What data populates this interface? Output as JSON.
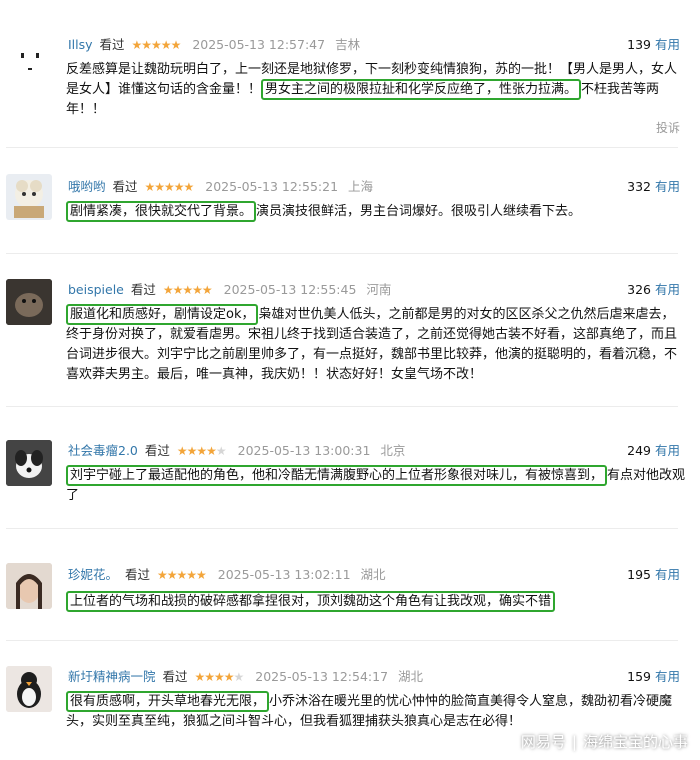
{
  "reviews": [
    {
      "user": "Illsy",
      "watched": "看过",
      "stars": 5,
      "time": "2025-05-13 12:57:47",
      "location": "吉林",
      "votes": "139",
      "useful": "有用",
      "text_before": "反差感算是让魏劭玩明白了，上一刻还是地狱修罗，下一刻秒变纯情狼狗，苏的一批！【男人是男人，女人是女人】谁懂这句话的含金量！！",
      "highlight": "男女主之间的极限拉扯和化学反应绝了，性张力拉满。",
      "text_after": "不枉我苦等两年！！",
      "report": "投诉"
    },
    {
      "user": "哦哟哟",
      "watched": "看过",
      "stars": 5,
      "time": "2025-05-13 12:55:21",
      "location": "上海",
      "votes": "332",
      "useful": "有用",
      "text_before": "",
      "highlight": "剧情紧凑，很快就交代了背景。",
      "text_after": "演员演技很鲜活，男主台词爆好。很吸引人继续看下去。"
    },
    {
      "user": "beispiele",
      "watched": "看过",
      "stars": 5,
      "time": "2025-05-13 12:55:45",
      "location": "河南",
      "votes": "326",
      "useful": "有用",
      "text_before": "",
      "highlight": "服道化和质感好，剧情设定ok，",
      "text_after": "枭雄对世仇美人低头，之前都是男的对女的区区杀父之仇然后虐来虐去，终于身份对换了，就爱看虐男。宋祖儿终于找到适合装造了，之前还觉得她古装不好看，这部真绝了，而且台词进步很大。刘宇宁比之前剧里帅多了，有一点挺好，魏部书里比较莽，他演的挺聪明的，看着沉稳，不喜欢莽夫男主。最后，唯一真神，我庆奶！！状态好好！女皇气场不改！"
    },
    {
      "user": "社会毒瘤2.0",
      "watched": "看过",
      "stars": 4,
      "time": "2025-05-13 13:00:31",
      "location": "北京",
      "votes": "249",
      "useful": "有用",
      "text_before": "",
      "highlight": "刘宇宁碰上了最适配他的角色，他和冷酷无情满腹野心的上位者形象很对味儿，有被惊喜到，",
      "text_after": "有点对他改观了"
    },
    {
      "user": "珍妮花。",
      "watched": "看过",
      "stars": 5,
      "time": "2025-05-13 13:02:11",
      "location": "湖北",
      "votes": "195",
      "useful": "有用",
      "text_before": "",
      "highlight": "上位者的气场和战损的破碎感都拿捏很对，顶刘魏劭这个角色有让我改观，确实不错",
      "text_after": ""
    },
    {
      "user": "新圩精神病一院",
      "watched": "看过",
      "stars": 4,
      "time": "2025-05-13 12:54:17",
      "location": "湖北",
      "votes": "159",
      "useful": "有用",
      "text_before": "",
      "highlight": "很有质感啊，开头草地春光无限，",
      "text_after": "小乔沐浴在暖光里的忧心忡忡的脸简直美得令人窒息，魏劭初看冷硬魔头，实则至真至纯，狼狐之间斗智斗心，但我看狐狸捕获头狼真心是志在必得！"
    }
  ],
  "watermark": {
    "platform": "网易号",
    "author": "海绵宝宝的心事"
  },
  "colors": {
    "link": "#3377aa",
    "star": "#f3a53a",
    "highlight_border": "#2fa62f",
    "meta_gray": "#9a9a9a"
  }
}
